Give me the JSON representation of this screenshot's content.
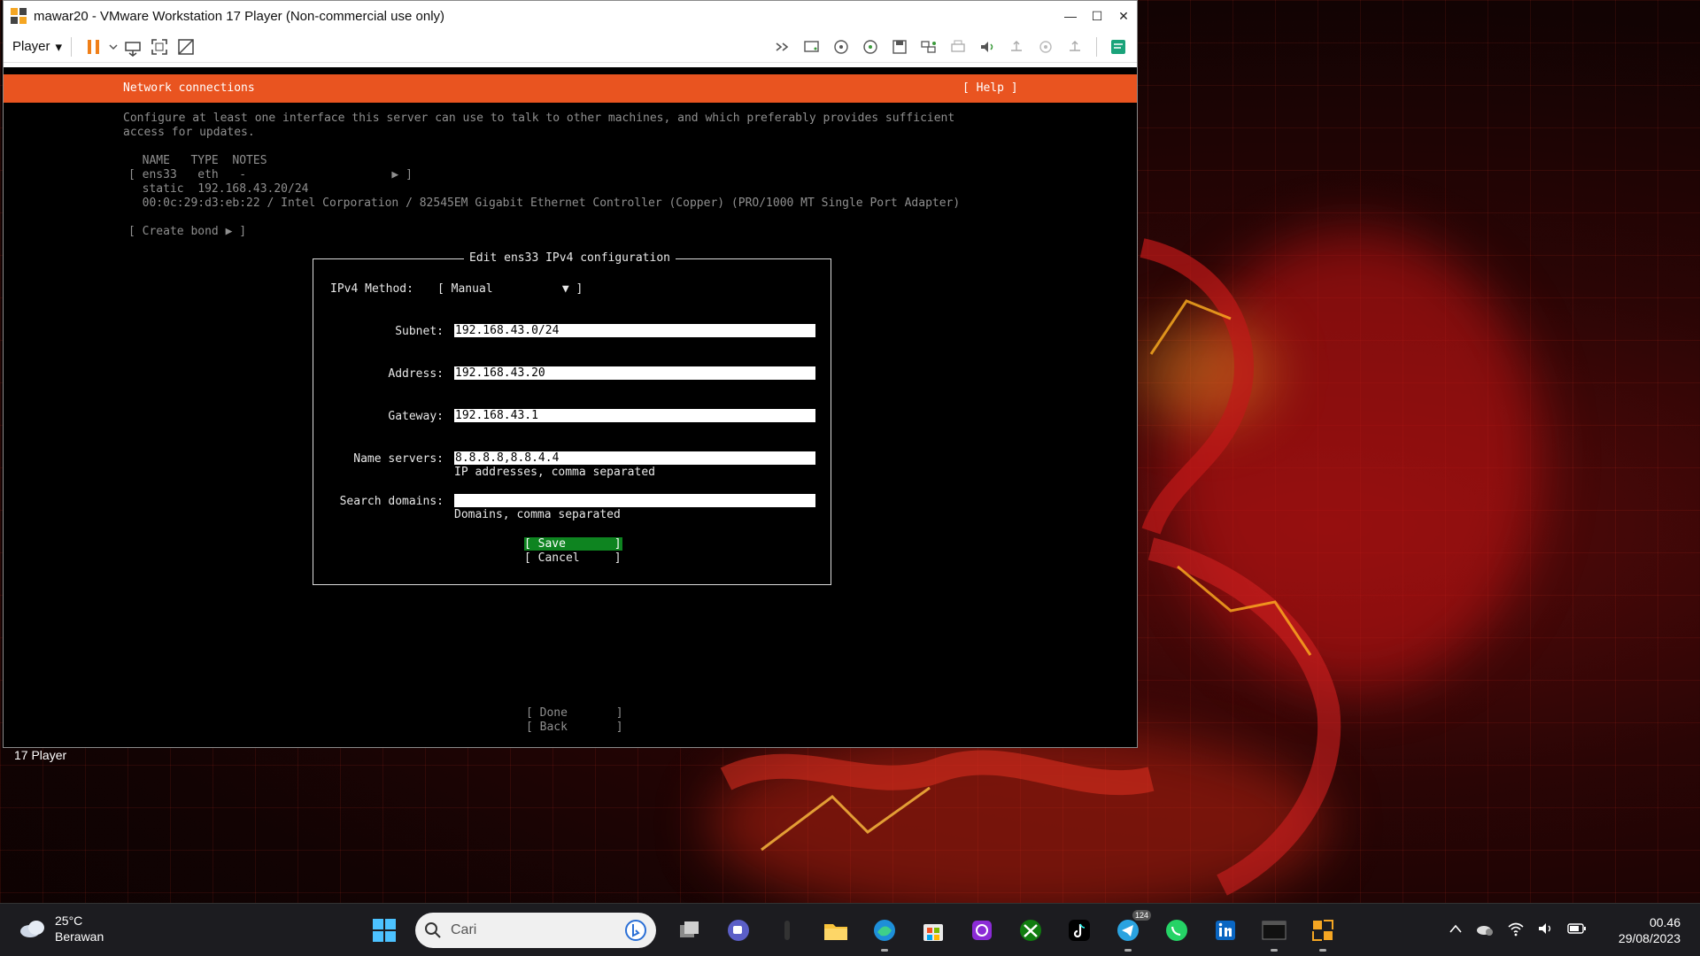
{
  "window": {
    "title": "mawar20 - VMware Workstation 17 Player (Non-commercial use only)",
    "minimize": "—",
    "maximize": "☐",
    "close": "✕"
  },
  "toolbar": {
    "player_label": "Player"
  },
  "console": {
    "header_title": "Network connections",
    "help": "[ Help ]",
    "intro_line1": "Configure at least one interface this server can use to talk to other machines, and which preferably provides sufficient",
    "intro_line2": "access for updates.",
    "table_header": "  NAME   TYPE  NOTES",
    "iface_row": "[ ens33   eth   -                     ▶ ]",
    "iface_static": "  static  192.168.43.20/24",
    "iface_hw": "  00:0c:29:d3:eb:22 / Intel Corporation / 82545EM Gigabit Ethernet Controller (Copper) (PRO/1000 MT Single Port Adapter)",
    "create_bond": "[ Create bond ▶ ]",
    "dialog": {
      "title": "Edit ens33 IPv4 configuration",
      "method_label": "IPv4 Method:",
      "method_value": "[ Manual          ▼ ]",
      "subnet_label": "Subnet:",
      "subnet_value": "192.168.43.0/24",
      "address_label": "Address:",
      "address_value": "192.168.43.20",
      "gateway_label": "Gateway:",
      "gateway_value": "192.168.43.1",
      "nameservers_label": "Name servers:",
      "nameservers_value": "8.8.8.8,8.8.4.4",
      "nameservers_hint": "IP addresses, comma separated",
      "search_label": "Search domains:",
      "search_value": "",
      "search_hint": "Domains, comma separated",
      "save": "[ Save       ]",
      "cancel": "[ Cancel     ]"
    },
    "done": "[ Done       ]",
    "back": "[ Back       ]"
  },
  "vm_label": "17 Player",
  "taskbar": {
    "temperature": "25°C",
    "condition": "Berawan",
    "search_placeholder": "Cari",
    "telegram_badge": "124",
    "time": "00.46",
    "date": "29/08/2023"
  },
  "colors": {
    "ubuntu_orange": "#e95420",
    "save_green": "#0e8420",
    "pause_orange": "#f07f18"
  }
}
